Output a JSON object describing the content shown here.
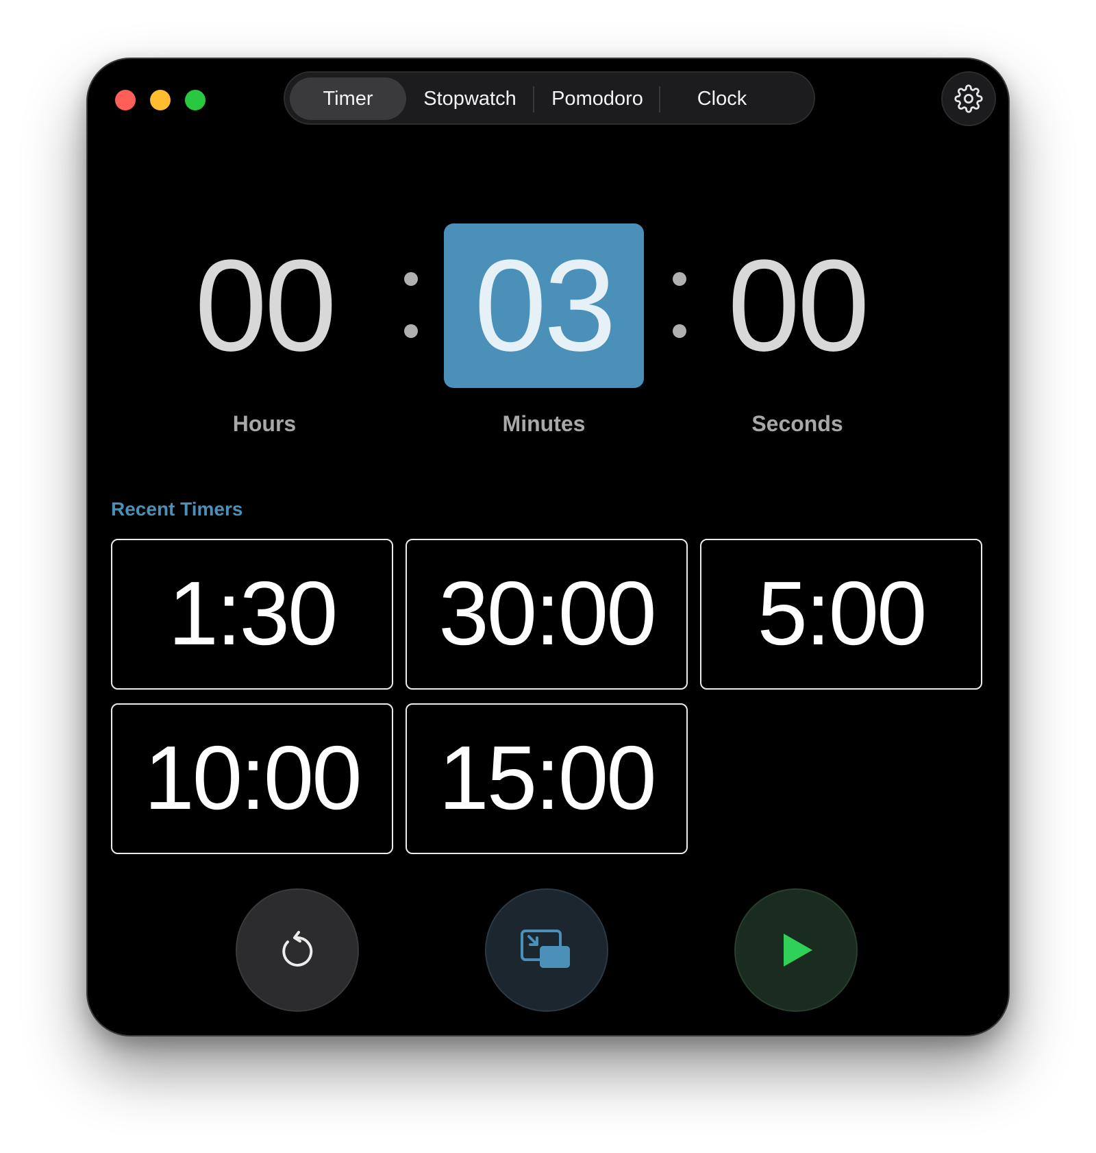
{
  "window": {
    "traffic_lights": [
      "close",
      "minimize",
      "maximize"
    ]
  },
  "tabs": [
    {
      "label": "Timer",
      "active": true
    },
    {
      "label": "Stopwatch",
      "active": false
    },
    {
      "label": "Pomodoro",
      "active": false
    },
    {
      "label": "Clock",
      "active": false
    }
  ],
  "settings": {
    "icon": "gear-icon"
  },
  "timer": {
    "hours": "00",
    "minutes": "03",
    "seconds": "00",
    "hours_label": "Hours",
    "minutes_label": "Minutes",
    "seconds_label": "Seconds",
    "selected_field": "minutes"
  },
  "recent": {
    "heading": "Recent Timers",
    "items": [
      "1:30",
      "30:00",
      "5:00",
      "10:00",
      "15:00"
    ]
  },
  "controls": {
    "reset_icon": "reset-icon",
    "pip_icon": "picture-in-picture-icon",
    "play_icon": "play-icon"
  },
  "colors": {
    "accent": "#4a90b8",
    "play": "#30d158",
    "background": "#000000"
  }
}
